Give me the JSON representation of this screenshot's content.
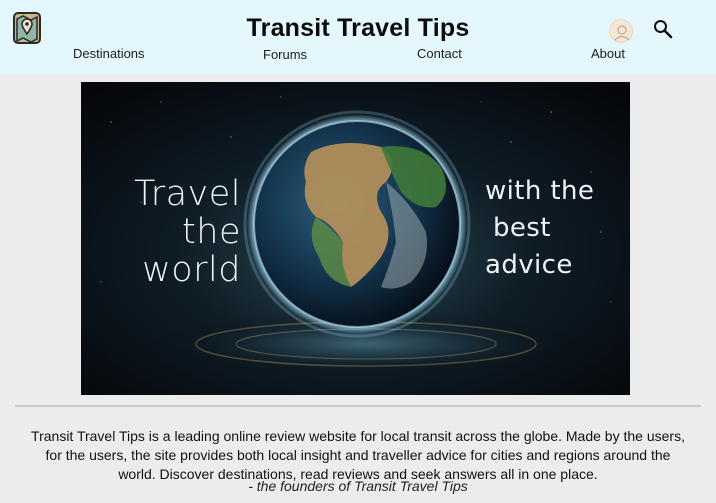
{
  "header": {
    "title": "Transit Travel Tips",
    "logo_icon": "map-pin-logo-icon",
    "avatar_icon": "user-avatar-icon",
    "search_icon": "search-icon",
    "nav": {
      "destinations": "Destinations",
      "forums": "Forums",
      "contact": "Contact",
      "about": "About"
    },
    "background": "#e4f7fd"
  },
  "hero": {
    "image": "earth-globe-illustration",
    "left_lines": [
      "Travel",
      "the",
      "world"
    ],
    "right_lines": [
      "with the",
      "best",
      "advice"
    ]
  },
  "intro": {
    "text": "Transit Travel Tips is a leading online review website for local transit across the globe. Made by the users, for the users, the site provides both local insight and traveller advice for cities and regions around the world. Discover destinations, read reviews and seek answers all in one place.",
    "signature": "- the founders of Transit Travel Tips"
  }
}
